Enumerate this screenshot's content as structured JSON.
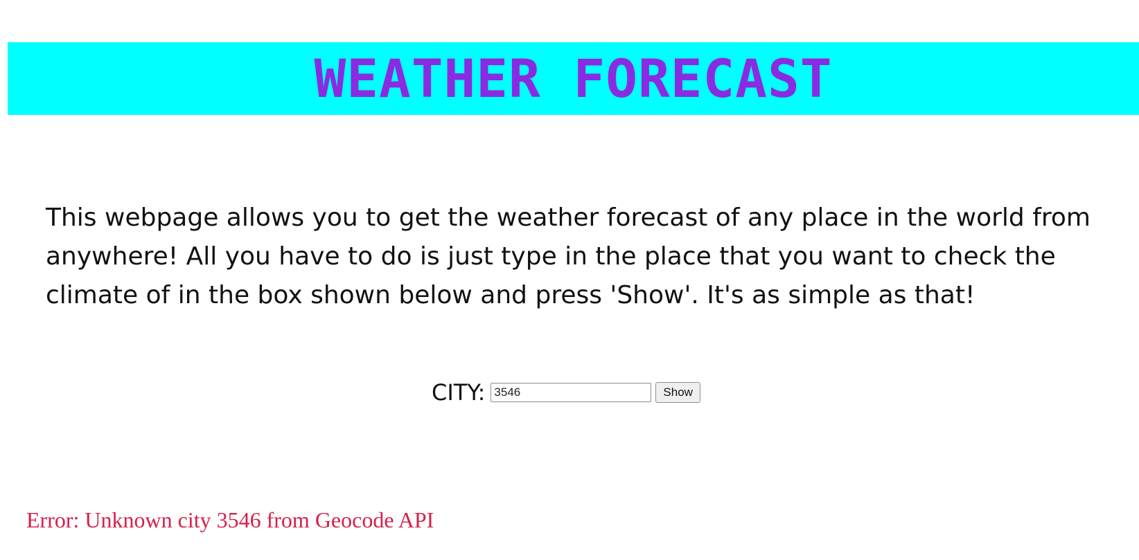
{
  "header": {
    "title": "WEATHER FORECAST"
  },
  "intro": {
    "text": "This webpage allows you to get the weather forecast of any place in the world from anywhere! All you have to do is just type in the place that you want to check the climate of in the box shown below and press 'Show'. It's as simple as that!"
  },
  "form": {
    "city_label": "CITY:",
    "city_value": "3546",
    "show_label": "Show"
  },
  "error": {
    "message": "Error: Unknown city 3546 from Geocode API"
  },
  "colors": {
    "banner_background": "#00ffff",
    "title_color": "#8a2be2",
    "error_color": "#d6204a"
  }
}
